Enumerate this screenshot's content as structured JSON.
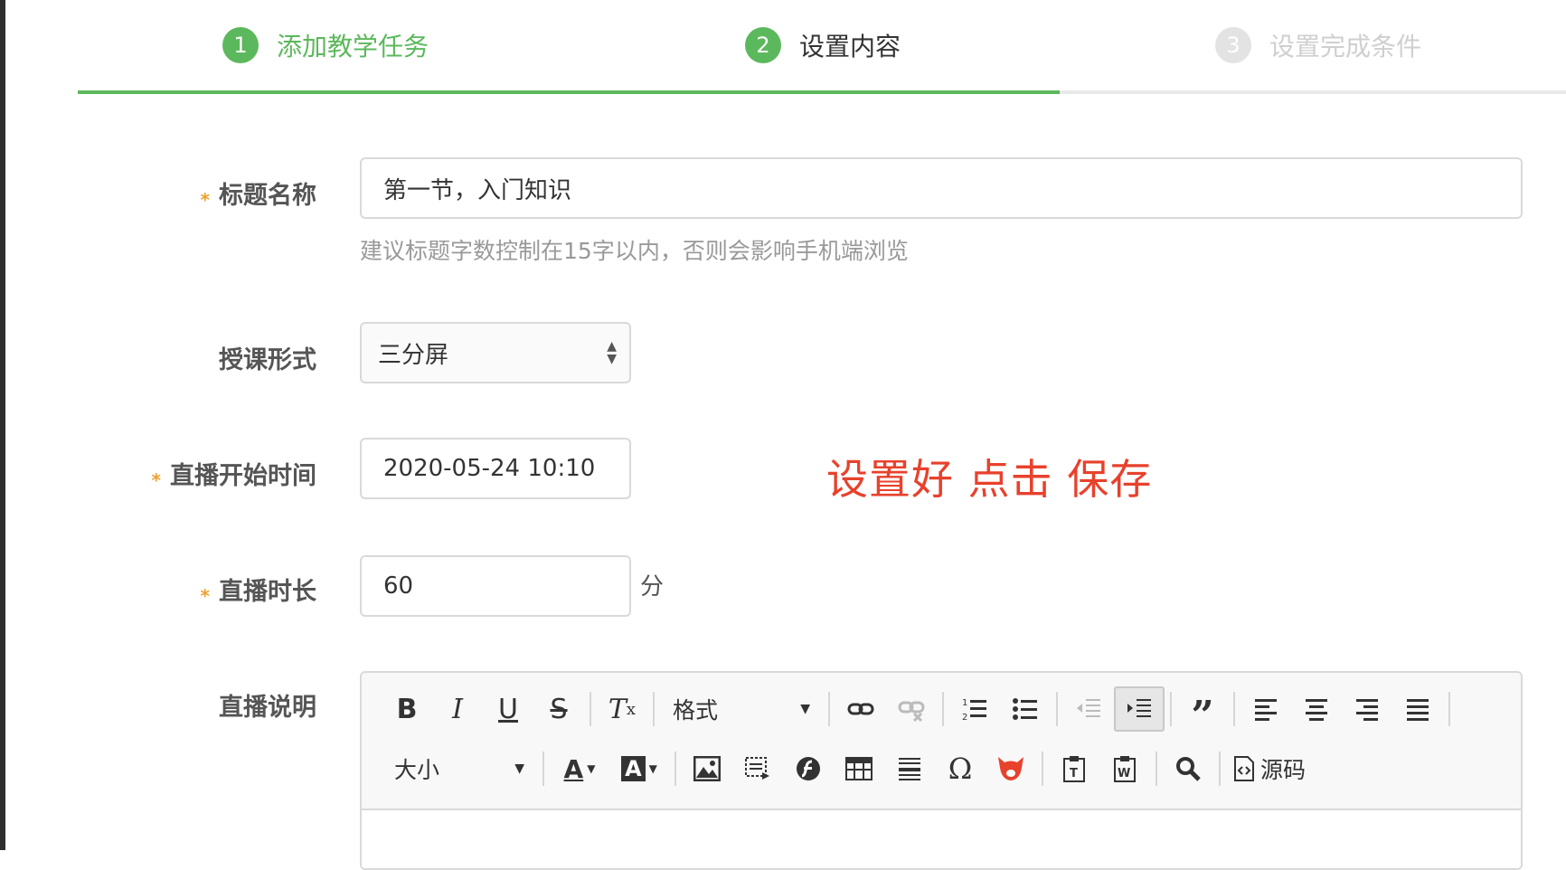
{
  "steps": [
    {
      "num": "1",
      "label": "添加教学任务"
    },
    {
      "num": "2",
      "label": "设置内容"
    },
    {
      "num": "3",
      "label": "设置完成条件"
    }
  ],
  "step_progress": 0.66,
  "colors": {
    "accent": "#5cb85c",
    "required": "#f0a030",
    "annotation": "#e8412c"
  },
  "form": {
    "title": {
      "label": "标题名称",
      "required_mark": "*",
      "value": "第一节，入门知识",
      "hint": "建议标题字数控制在15字以内，否则会影响手机端浏览"
    },
    "format": {
      "label": "授课形式",
      "selected": "三分屏"
    },
    "start_time": {
      "label": "直播开始时间",
      "required_mark": "*",
      "value": "2020-05-24 10:10"
    },
    "duration": {
      "label": "直播时长",
      "required_mark": "*",
      "value": "60",
      "unit": "分"
    },
    "description": {
      "label": "直播说明"
    }
  },
  "annotation": "设置好 点击 保存",
  "editor": {
    "format_dropdown": "格式",
    "size_dropdown": "大小",
    "source_label": "源码"
  }
}
